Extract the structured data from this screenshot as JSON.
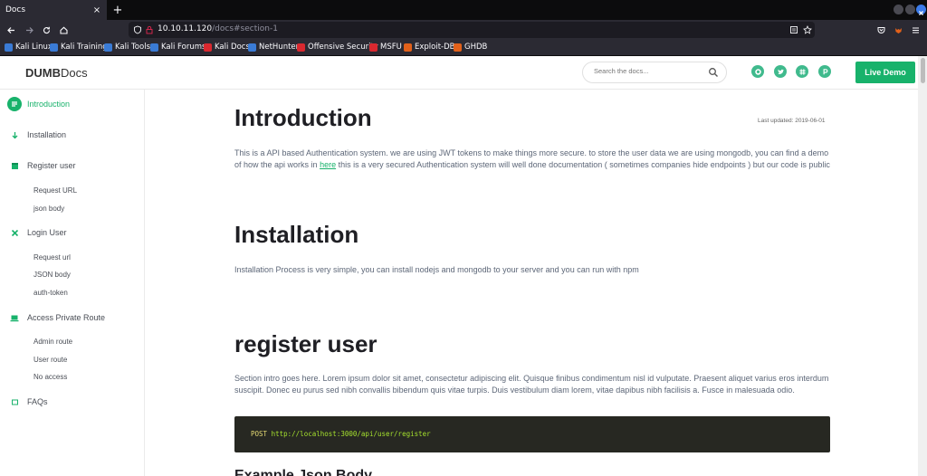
{
  "browser": {
    "tab_title": "Docs",
    "tab_close": "×",
    "new_tab": "+",
    "url_host": "10.10.11.120",
    "url_path": "/docs#section-1",
    "bookmarks": [
      {
        "label": "Kali Linux",
        "color": "#3a7bd5"
      },
      {
        "label": "Kali Training",
        "color": "#3a7bd5"
      },
      {
        "label": "Kali Tools",
        "color": "#3a7bd5"
      },
      {
        "label": "Kali Forums",
        "color": "#3a7bd5"
      },
      {
        "label": "Kali Docs",
        "color": "#d9282f"
      },
      {
        "label": "NetHunter",
        "color": "#3a7bd5"
      },
      {
        "label": "Offensive Security",
        "color": "#d9282f"
      },
      {
        "label": "MSFU",
        "color": "#d9282f"
      },
      {
        "label": "Exploit-DB",
        "color": "#e2611a"
      },
      {
        "label": "GHDB",
        "color": "#e2611a"
      }
    ]
  },
  "header": {
    "logo_bold": "DUMB",
    "logo_rest": "Docs",
    "search_placeholder": "Search the docs...",
    "live_demo": "Live Demo"
  },
  "sidebar": {
    "items": [
      {
        "label": "Introduction",
        "icon": "list-icon"
      },
      {
        "label": "Installation",
        "icon": "arrow-down-icon"
      },
      {
        "label": "Register user",
        "icon": "box-icon",
        "subs": [
          "Request URL",
          "json body"
        ]
      },
      {
        "label": "Login User",
        "icon": "tools-icon",
        "subs": [
          "Request url",
          "JSON body",
          "auth-token"
        ]
      },
      {
        "label": "Access Private Route",
        "icon": "laptop-icon",
        "subs": [
          "Admin route",
          "User route",
          "No access"
        ]
      },
      {
        "label": "FAQs",
        "icon": "tablet-icon"
      }
    ]
  },
  "main": {
    "intro_title": "Introduction",
    "last_updated": "Last updated: 2019-06-01",
    "intro_text_1": "This is a API based Authentication system. we are using JWT tokens to make things more secure. to store the user data we are using mongodb, you can find a demo of how the api works in ",
    "intro_link": "here",
    "intro_text_2": " this is a very secured Authentication system will well done documentation ( sometimes companies hide endpoints ) but our code is public",
    "install_title": "Installation",
    "install_text": "Installation Process is very simple, you can install nodejs and mongodb to your server and you can run with npm",
    "register_title": "register user",
    "register_text": "Section intro goes here. Lorem ipsum dolor sit amet, consectetur adipiscing elit. Quisque finibus condimentum nisl id vulputate. Praesent aliquet varius eros interdum suscipit. Donec eu purus sed nibh convallis bibendum quis vitae turpis. Duis vestibulum diam lorem, vitae dapibus nibh facilisis a. Fusce in malesuada odio.",
    "code_method": "POST",
    "code_url": "http://localhost:3000/api/user/register",
    "example_title": "Example Json Body"
  },
  "colors": {
    "accent": "#18b26b"
  }
}
